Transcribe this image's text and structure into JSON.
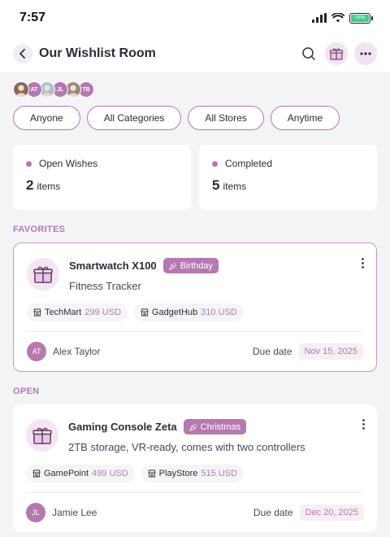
{
  "status": {
    "time": "7:57",
    "battery": "100%"
  },
  "header": {
    "title": "Our Wishlist Room"
  },
  "members": [
    {
      "initials": "",
      "color": "#8a6a5a",
      "photo": true
    },
    {
      "initials": "AT",
      "color": "#b678b0",
      "photo": false
    },
    {
      "initials": "",
      "color": "#a9c3cf",
      "photo": true
    },
    {
      "initials": "JL",
      "color": "#b678b0",
      "photo": false
    },
    {
      "initials": "",
      "color": "#9a8a7f",
      "photo": true
    },
    {
      "initials": "TB",
      "color": "#b678b0",
      "photo": false
    }
  ],
  "filters": {
    "person": "Anyone",
    "category": "All Categories",
    "store": "All Stores",
    "time": "Anytime"
  },
  "stats": {
    "open": {
      "label": "Open Wishes",
      "count": "2",
      "unit": "items"
    },
    "completed": {
      "label": "Completed",
      "count": "5",
      "unit": "items"
    }
  },
  "sections": {
    "favorites": "FAVORITES",
    "open": "OPEN"
  },
  "wishes": [
    {
      "title": "Smartwatch X100",
      "occasion": "Birthday",
      "description": "Fitness Tracker",
      "stores": [
        {
          "name": "TechMart",
          "price": "299 USD"
        },
        {
          "name": "GadgetHub",
          "price": "310 USD"
        }
      ],
      "owner_initials": "AT",
      "owner_name": "Alex Taylor",
      "due_label": "Due date",
      "due_date": "Nov 15, 2025"
    },
    {
      "title": "Gaming Console Zeta",
      "occasion": "Christmas",
      "description": "2TB storage, VR-ready, comes with two controllers",
      "stores": [
        {
          "name": "GamePoint",
          "price": "499 USD"
        },
        {
          "name": "PlayStore",
          "price": "515 USD"
        }
      ],
      "owner_initials": "JL",
      "owner_name": "Jamie Lee",
      "due_label": "Due date",
      "due_date": "Dec 20, 2025"
    }
  ],
  "colors": {
    "accent": "#b678b0",
    "accent_soft": "#f3e6f2"
  }
}
